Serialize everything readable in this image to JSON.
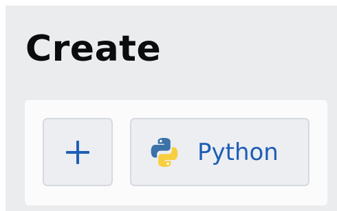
{
  "section": {
    "title": "Create"
  },
  "actions": {
    "add": {
      "icon": "plus-icon"
    },
    "python": {
      "label": "Python",
      "icon": "python-logo-icon"
    }
  },
  "colors": {
    "panel_bg": "#ebecee",
    "card_bg": "#fbfbfc",
    "button_bg": "#eceef2",
    "accent": "#1c5db5",
    "python_blue": "#3b72a8",
    "python_yellow": "#f7cf3e"
  }
}
